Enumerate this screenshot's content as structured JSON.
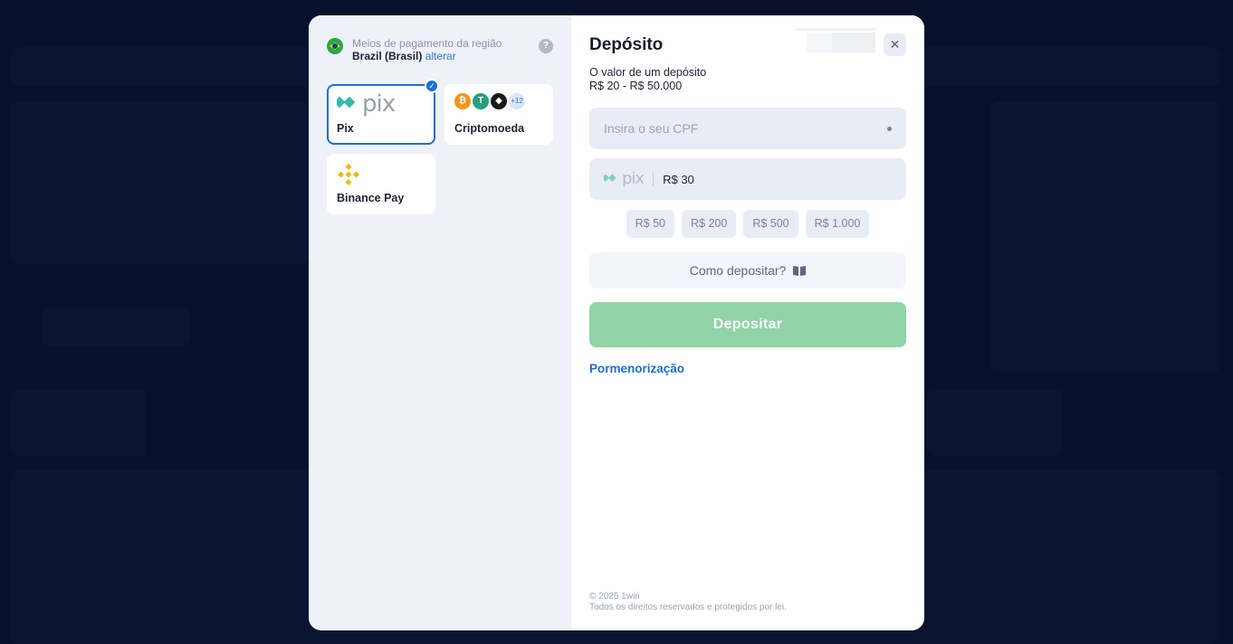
{
  "region": {
    "title": "Meios de pagamento da região",
    "country": "Brazil (Brasil)",
    "change_label": "alterar",
    "help_label": "?"
  },
  "methods": [
    {
      "label": "Pix",
      "logo_text": "pix",
      "selected": true
    },
    {
      "label": "Criptomoeda",
      "coins": [
        "₿",
        "T",
        "◆"
      ],
      "more": "+12",
      "selected": false
    },
    {
      "label": "Binance Pay",
      "selected": false
    }
  ],
  "deposit": {
    "title": "Depósito",
    "range_label": "O valor de um depósito",
    "range_value": "R$ 20 - R$ 50.000",
    "cpf_placeholder": "Insira o seu CPF",
    "amount_logo_text": "pix",
    "amount_value": "R$ 30",
    "quick_amounts": [
      "R$ 50",
      "R$ 200",
      "R$ 500",
      "R$ 1.000"
    ],
    "how_label": "Como depositar?",
    "submit_label": "Depositar",
    "details_label": "Pormenorização",
    "close_label": "✕"
  },
  "footer": {
    "copyright": "© 2025 1win",
    "rights": "Todos os direitos reservados e protegidos por lei."
  },
  "colors": {
    "accent": "#1a6fd6",
    "submit_disabled": "#8fd3a7",
    "pix_green": "#32bcad",
    "binance_yellow": "#f0b90b"
  }
}
